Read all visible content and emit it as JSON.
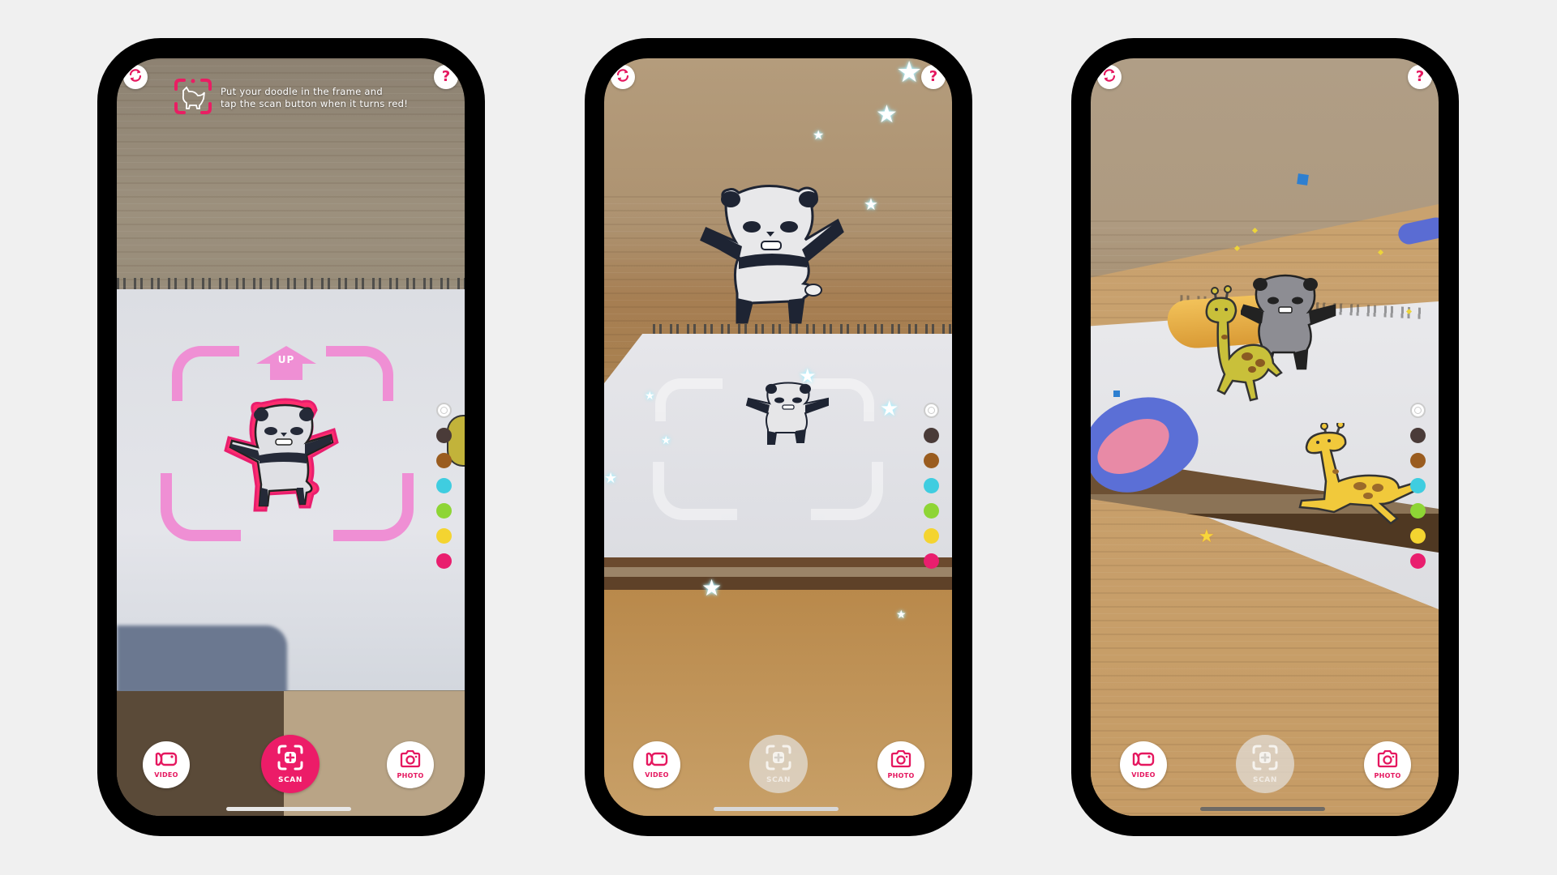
{
  "background_color": "#f0f0f0",
  "accent_color": "#ec1c68",
  "phones": [
    {
      "id": "scan-mode",
      "top_left_button": "refresh-icon",
      "top_right_button": "help-icon",
      "hint": {
        "icon": "scan-frame-cat-icon",
        "line1": "Put your doodle in the frame and",
        "line2": "tap the scan button when it turns red!"
      },
      "frame_label": "UP",
      "scan_state": "active",
      "buttons": {
        "video": "VIDEO",
        "scan": "SCAN",
        "photo": "PHOTO"
      }
    },
    {
      "id": "panda-pop-out",
      "top_left_button": "refresh-icon",
      "top_right_button": "help-icon",
      "scan_state": "disabled",
      "buttons": {
        "video": "VIDEO",
        "scan": "SCAN",
        "photo": "PHOTO"
      }
    },
    {
      "id": "multiple-characters",
      "top_left_button": "refresh-icon",
      "top_right_button": "help-icon",
      "scan_state": "disabled",
      "buttons": {
        "video": "VIDEO",
        "scan": "SCAN",
        "photo": "PHOTO"
      }
    }
  ],
  "palette": [
    {
      "name": "eraser",
      "color": "#ffffff"
    },
    {
      "name": "dark-brown",
      "color": "#4a3b38"
    },
    {
      "name": "brown",
      "color": "#9a5c1f"
    },
    {
      "name": "cyan",
      "color": "#3fcde0"
    },
    {
      "name": "green",
      "color": "#8ed535"
    },
    {
      "name": "yellow",
      "color": "#f4d430"
    },
    {
      "name": "pink",
      "color": "#e91e6e"
    }
  ]
}
